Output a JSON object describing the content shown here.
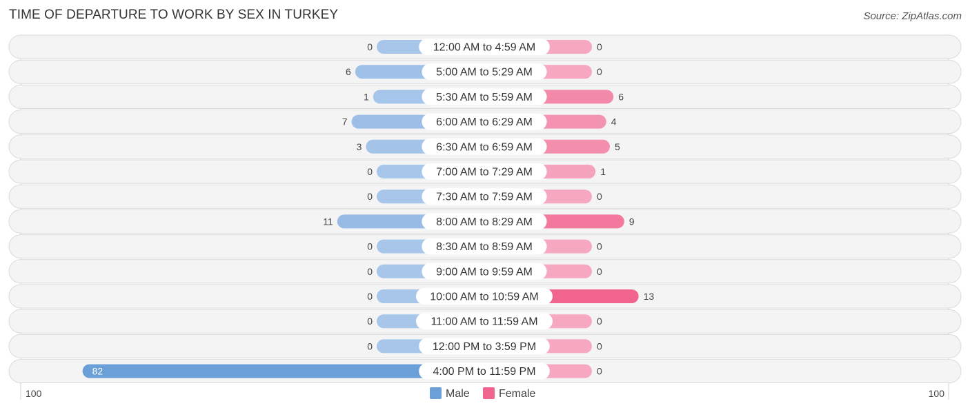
{
  "title": "TIME OF DEPARTURE TO WORK BY SEX IN TURKEY",
  "source": "Source: ZipAtlas.com",
  "chart_data": {
    "type": "bar",
    "orientation": "horizontal-diverging",
    "title": "TIME OF DEPARTURE TO WORK BY SEX IN TURKEY",
    "categories": [
      "12:00 AM to 4:59 AM",
      "5:00 AM to 5:29 AM",
      "5:30 AM to 5:59 AM",
      "6:00 AM to 6:29 AM",
      "6:30 AM to 6:59 AM",
      "7:00 AM to 7:29 AM",
      "7:30 AM to 7:59 AM",
      "8:00 AM to 8:29 AM",
      "8:30 AM to 8:59 AM",
      "9:00 AM to 9:59 AM",
      "10:00 AM to 10:59 AM",
      "11:00 AM to 11:59 AM",
      "12:00 PM to 3:59 PM",
      "4:00 PM to 11:59 PM"
    ],
    "series": [
      {
        "name": "Male",
        "color": "#6a9fd8",
        "light_color": "#a8c6ea",
        "values": [
          0,
          6,
          1,
          7,
          3,
          0,
          0,
          11,
          0,
          0,
          0,
          0,
          0,
          82
        ]
      },
      {
        "name": "Female",
        "color": "#f0648e",
        "light_color": "#f5a8c0",
        "values": [
          0,
          0,
          6,
          4,
          5,
          1,
          0,
          9,
          0,
          0,
          13,
          0,
          0,
          0
        ]
      }
    ],
    "axis": {
      "left_label": "100",
      "right_label": "100",
      "range": [
        0,
        100
      ]
    },
    "legend": {
      "position": "bottom-center",
      "items": [
        "Male",
        "Female"
      ]
    }
  }
}
